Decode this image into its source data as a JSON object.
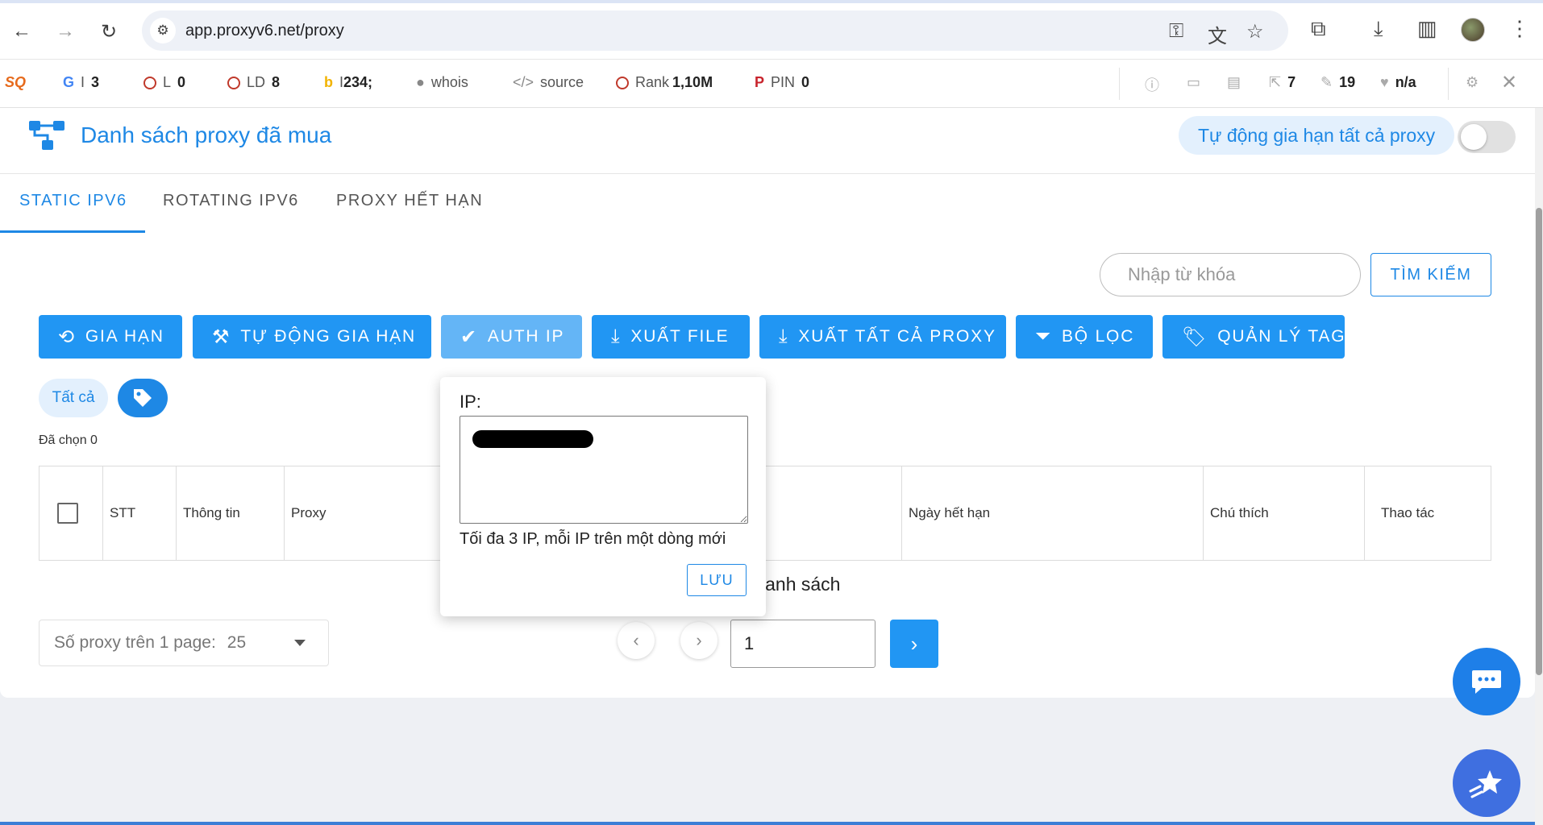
{
  "browser": {
    "url": "app.proxyv6.net/proxy"
  },
  "extension_bar": {
    "google": {
      "label": "I",
      "value": "3"
    },
    "l": {
      "label": "L",
      "value": "0"
    },
    "ld": {
      "label": "LD",
      "value": "8"
    },
    "bing": {
      "label": "I",
      "value": "234;"
    },
    "whois": "whois",
    "source": "source",
    "rank": {
      "label": "Rank",
      "value": "1,10M"
    },
    "pin": {
      "label": "PIN",
      "value": "0"
    },
    "links_out": "7",
    "links_in": "19",
    "health": "n/a"
  },
  "header": {
    "title": "Danh sách proxy đã mua",
    "auto_renew_all": "Tự động gia hạn tất cả proxy"
  },
  "tabs": [
    {
      "label": "STATIC IPV6",
      "active": true
    },
    {
      "label": "ROTATING IPV6",
      "active": false
    },
    {
      "label": "PROXY HẾT HẠN",
      "active": false
    }
  ],
  "search": {
    "placeholder": "Nhập từ khóa",
    "button": "TÌM KIẾM"
  },
  "actions": {
    "renew": "GIA HẠN",
    "auto_renew": "TỰ ĐỘNG GIA HẠN",
    "auth_ip": "AUTH IP",
    "export_file": "XUẤT FILE",
    "export_all": "XUẤT TẤT CẢ PROXY",
    "filter": "BỘ LỌC",
    "manage_tag": "QUẢN LÝ TAG"
  },
  "filters": {
    "all": "Tất cả"
  },
  "selected": "Đã chọn 0",
  "table": {
    "columns": [
      "STT",
      "Thông tin",
      "Proxy",
      "Ngày hết hạn",
      "Chú thích",
      "Thao tác"
    ],
    "empty_text": "lanh sách"
  },
  "pagination": {
    "per_page_label": "Số proxy trên 1 page:",
    "per_page_value": "25",
    "page": "1"
  },
  "popover": {
    "label": "IP:",
    "hint": "Tối đa 3 IP, mỗi IP trên một dòng mới",
    "save": "LƯU"
  },
  "colors": {
    "primary": "#2196f3",
    "primary_dark": "#1e88e5",
    "chip_bg": "#e3f0fd"
  }
}
